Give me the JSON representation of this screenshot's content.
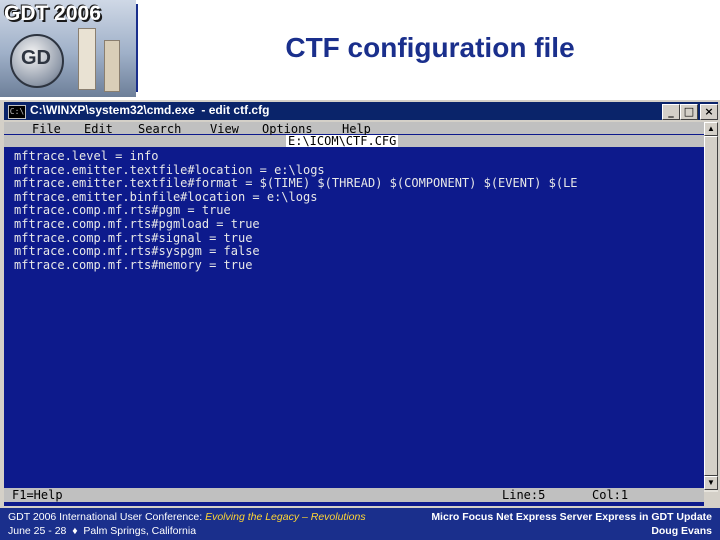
{
  "logo": {
    "text": "GDT 2006",
    "mark": "GD"
  },
  "slide": {
    "title": "CTF configuration file"
  },
  "window": {
    "title": "C:\\WINXP\\system32\\cmd.exe  - edit ctf.cfg",
    "icon": "console-icon",
    "buttons": {
      "minimize": "_",
      "maximize": "□",
      "close": "×"
    }
  },
  "editor": {
    "menu": [
      "File",
      "Edit",
      "Search",
      "View",
      "Options",
      "Help"
    ],
    "filename": "E:\\ICOM\\CTF.CFG",
    "lines": [
      "mftrace.level = info",
      "mftrace.emitter.textfile#location = e:\\logs",
      "mftrace.emitter.textfile#format = $(TIME) $(THREAD) $(COMPONENT) $(EVENT) $(LE",
      "mftrace.emitter.binfile#location = e:\\logs",
      "mftrace.comp.mf.rts#pgm = true",
      "mftrace.comp.mf.rts#pgmload = true",
      "mftrace.comp.mf.rts#signal = true",
      "mftrace.comp.mf.rts#syspgm = false",
      "mftrace.comp.mf.rts#memory = true"
    ],
    "status": {
      "help": "F1=Help",
      "line": "Line:5",
      "col": "Col:1"
    }
  },
  "footer": {
    "conf": "GDT 2006 International User Conference: ",
    "tagline": "Evolving the Legacy – Revolutions",
    "dates": "June 25 - 28  ♦  Palm Springs, California",
    "topic": "Micro Focus Net Express Server Express in GDT Update",
    "author": "Doug Evans"
  },
  "colors": {
    "accent": "#1a2f8c",
    "console_bg": "#0d1a8c",
    "titlebar": "#0a246a",
    "tagline": "#ffd633"
  }
}
